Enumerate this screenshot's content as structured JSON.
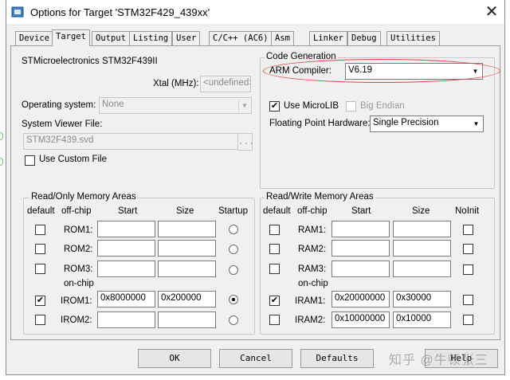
{
  "window": {
    "title": "Options for Target 'STM32F429_439xx'",
    "close_glyph": "✕"
  },
  "tabs": [
    {
      "label": "Device"
    },
    {
      "label": "Target"
    },
    {
      "label": "Output"
    },
    {
      "label": "Listing"
    },
    {
      "label": "User"
    },
    {
      "label": "C/C++ (AC6)"
    },
    {
      "label": "Asm"
    },
    {
      "label": "Linker"
    },
    {
      "label": "Debug"
    },
    {
      "label": "Utilities"
    }
  ],
  "active_tab": "Target",
  "device": {
    "name": "STMicroelectronics STM32F439II",
    "xtal_label": "Xtal (MHz):",
    "xtal_value": "<undefined>",
    "os_label": "Operating system:",
    "os_value": "None",
    "svd_label": "System Viewer File:",
    "svd_value": "STM32F439.svd",
    "browse_label": "...",
    "use_custom_label": "Use Custom File",
    "use_custom_checked": false
  },
  "code_generation": {
    "title": "Code Generation",
    "compiler_label": "ARM Compiler:",
    "compiler_value": "V6.19",
    "use_microlib_label": "Use MicroLIB",
    "use_microlib_checked": true,
    "big_endian_label": "Big Endian",
    "big_endian_checked": false,
    "fph_label": "Floating Point Hardware:",
    "fph_value": "Single Precision"
  },
  "ro_memory": {
    "title": "Read/Only Memory Areas",
    "headers": {
      "default": "default",
      "offchip": "off-chip",
      "start": "Start",
      "size": "Size",
      "startup": "Startup"
    },
    "onchip_label": "on-chip",
    "rows": [
      {
        "name": "ROM1:",
        "start": "",
        "size": "",
        "default": false,
        "startup": false
      },
      {
        "name": "ROM2:",
        "start": "",
        "size": "",
        "default": false,
        "startup": false
      },
      {
        "name": "ROM3:",
        "start": "",
        "size": "",
        "default": false,
        "startup": false
      },
      {
        "name": "IROM1:",
        "start": "0x8000000",
        "size": "0x200000",
        "default": true,
        "startup": true
      },
      {
        "name": "IROM2:",
        "start": "",
        "size": "",
        "default": false,
        "startup": false
      }
    ]
  },
  "rw_memory": {
    "title": "Read/Write Memory Areas",
    "headers": {
      "default": "default",
      "offchip": "off-chip",
      "start": "Start",
      "size": "Size",
      "noinit": "NoInit"
    },
    "onchip_label": "on-chip",
    "rows": [
      {
        "name": "RAM1:",
        "start": "",
        "size": "",
        "default": false,
        "noinit": false
      },
      {
        "name": "RAM2:",
        "start": "",
        "size": "",
        "default": false,
        "noinit": false
      },
      {
        "name": "RAM3:",
        "start": "",
        "size": "",
        "default": false,
        "noinit": false
      },
      {
        "name": "IRAM1:",
        "start": "0x20000000",
        "size": "0x30000",
        "default": true,
        "noinit": false
      },
      {
        "name": "IRAM2:",
        "start": "0x10000000",
        "size": "0x10000",
        "default": false,
        "noinit": false
      }
    ]
  },
  "buttons": {
    "ok": "OK",
    "cancel": "Cancel",
    "defaults": "Defaults",
    "help": "Help"
  },
  "watermark": "知乎 @牛顿张三",
  "colors": {
    "highlight_ellipse": "#d94848",
    "dialog_bg": "#f0f0f0"
  }
}
